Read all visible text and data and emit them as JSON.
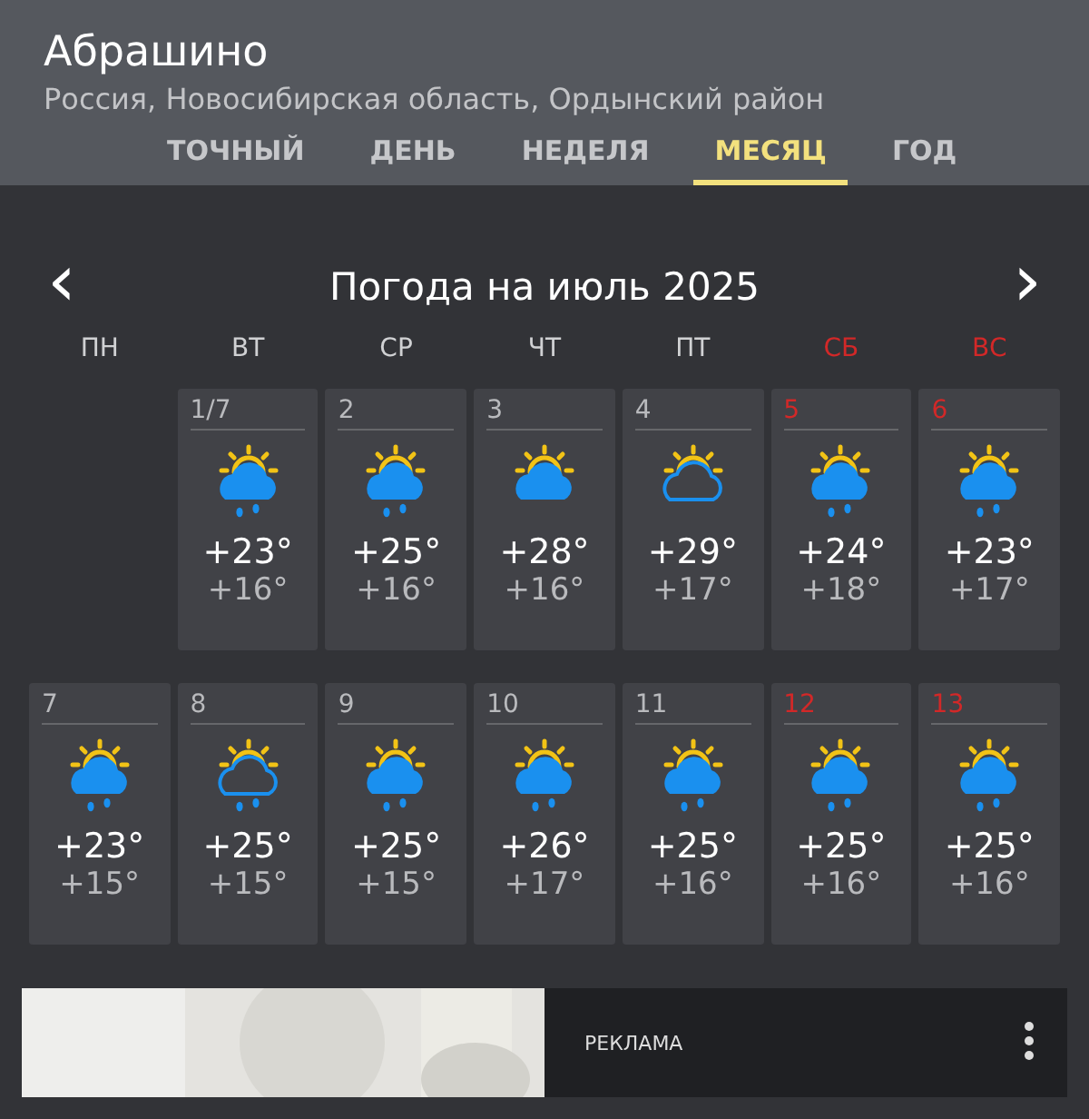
{
  "location": {
    "name": "Абрашино",
    "region": "Россия, Новосибирская область, Ордынский район"
  },
  "tabs": [
    {
      "label": "ТОЧНЫЙ",
      "selected": false
    },
    {
      "label": "ДЕНЬ",
      "selected": false
    },
    {
      "label": "НЕДЕЛЯ",
      "selected": false
    },
    {
      "label": "МЕСЯЦ",
      "selected": true
    },
    {
      "label": "ГОД",
      "selected": false
    }
  ],
  "month": {
    "prev": "‹",
    "title": "Погода на июль 2025",
    "next": "›"
  },
  "weekdays": [
    {
      "label": "ПН",
      "weekend": false
    },
    {
      "label": "ВТ",
      "weekend": false
    },
    {
      "label": "СР",
      "weekend": false
    },
    {
      "label": "ЧТ",
      "weekend": false
    },
    {
      "label": "ПТ",
      "weekend": false
    },
    {
      "label": "СБ",
      "weekend": true
    },
    {
      "label": "ВС",
      "weekend": true
    }
  ],
  "days": [
    {
      "date": "1/7",
      "weekend": false,
      "outline": false,
      "rain": true,
      "high": "+23°",
      "low": "+16°"
    },
    {
      "date": "2",
      "weekend": false,
      "outline": false,
      "rain": true,
      "high": "+25°",
      "low": "+16°"
    },
    {
      "date": "3",
      "weekend": false,
      "outline": false,
      "rain": false,
      "high": "+28°",
      "low": "+16°"
    },
    {
      "date": "4",
      "weekend": false,
      "outline": true,
      "rain": false,
      "high": "+29°",
      "low": "+17°"
    },
    {
      "date": "5",
      "weekend": true,
      "outline": false,
      "rain": true,
      "high": "+24°",
      "low": "+18°"
    },
    {
      "date": "6",
      "weekend": true,
      "outline": false,
      "rain": true,
      "high": "+23°",
      "low": "+17°"
    },
    {
      "date": "7",
      "weekend": false,
      "outline": false,
      "rain": true,
      "high": "+23°",
      "low": "+15°"
    },
    {
      "date": "8",
      "weekend": false,
      "outline": true,
      "rain": true,
      "high": "+25°",
      "low": "+15°"
    },
    {
      "date": "9",
      "weekend": false,
      "outline": false,
      "rain": true,
      "high": "+25°",
      "low": "+15°"
    },
    {
      "date": "10",
      "weekend": false,
      "outline": false,
      "rain": true,
      "high": "+26°",
      "low": "+17°"
    },
    {
      "date": "11",
      "weekend": false,
      "outline": false,
      "rain": true,
      "high": "+25°",
      "low": "+16°"
    },
    {
      "date": "12",
      "weekend": true,
      "outline": false,
      "rain": true,
      "high": "+25°",
      "low": "+16°"
    },
    {
      "date": "13",
      "weekend": true,
      "outline": false,
      "rain": true,
      "high": "+25°",
      "low": "+16°"
    }
  ],
  "ad": {
    "label": "РЕКЛАМА"
  }
}
